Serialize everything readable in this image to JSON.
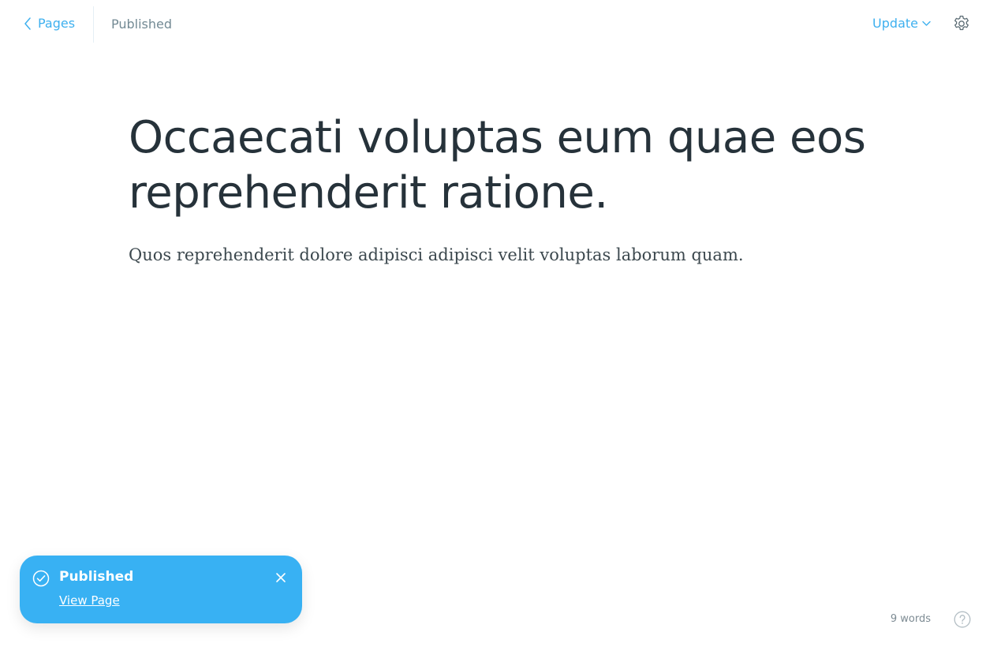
{
  "header": {
    "back_label": "Pages",
    "status": "Published",
    "update_label": "Update"
  },
  "editor": {
    "title": "Occaecati voluptas eum quae eos reprehenderit ratione.",
    "body": "Quos reprehenderit dolore adipisci adipisci velit voluptas laborum quam."
  },
  "toast": {
    "title": "Published",
    "link_label": "View Page",
    "background_color": "#38b1f3"
  },
  "footer": {
    "word_count": "9 words"
  },
  "colors": {
    "accent": "#3eb0ef",
    "text_dark": "#26323a",
    "text_muted": "#738a94"
  },
  "icons": {
    "back": "chevron-left-icon",
    "update_dropdown": "chevron-down-icon",
    "settings": "gear-icon",
    "toast_status": "check-circle-icon",
    "toast_close": "close-icon",
    "help": "question-circle-icon"
  }
}
